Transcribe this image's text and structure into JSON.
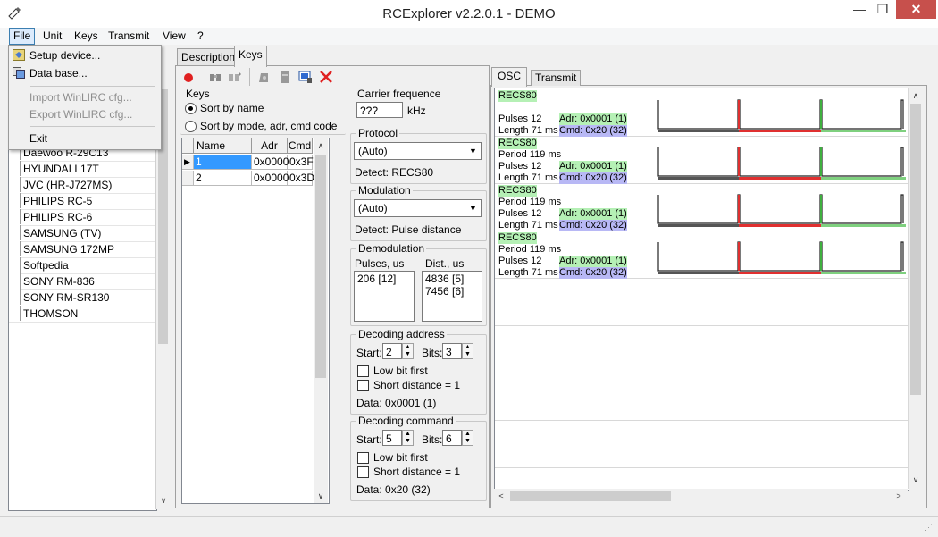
{
  "window": {
    "title": "RCExplorer v2.2.0.1 - DEMO",
    "min": "—",
    "max": "❐",
    "close": "✕"
  },
  "menu": [
    "File",
    "Unit",
    "Keys",
    "Transmit",
    "View",
    "?"
  ],
  "file_menu": {
    "setup": "Setup device...",
    "database": "Data base...",
    "import": "Import WinLIRC cfg...",
    "export": "Export WinLIRC cfg...",
    "exit": "Exit"
  },
  "devices": [
    "Daewoo R-29C13",
    "HYUNDAI L17T",
    "JVC (HR-J727MS)",
    "PHILIPS RC-5",
    "PHILIPS RC-6",
    "SAMSUNG (TV)",
    "SAMSUNG 172MP",
    "Softpedia",
    "SONY RM-836",
    "SONY RM-SR130",
    "THOMSON"
  ],
  "tabs": {
    "description": "Description",
    "keys": "Keys",
    "osc": "OSC",
    "transmit": "Transmit"
  },
  "keys_group": {
    "label": "Keys",
    "sort_name": "Sort by name",
    "sort_mode": "Sort by mode, adr, cmd code"
  },
  "grid": {
    "headers": {
      "name": "Name",
      "adr": "Adr",
      "cmd": "Cmd"
    },
    "rows": [
      {
        "name": "1",
        "adr": "0x0000",
        "cmd": "0x3F"
      },
      {
        "name": "2",
        "adr": "0x0000",
        "cmd": "0x3D"
      }
    ]
  },
  "carrier": {
    "label": "Carrier frequence",
    "value": "???",
    "unit": "kHz"
  },
  "protocol": {
    "label": "Protocol",
    "value": "(Auto)",
    "detect": "Detect: RECS80"
  },
  "modulation": {
    "label": "Modulation",
    "value": "(Auto)",
    "detect": "Detect: Pulse distance"
  },
  "demod": {
    "label": "Demodulation",
    "pulses_label": "Pulses, us",
    "dist_label": "Dist., us",
    "pulses": [
      "206 [12]"
    ],
    "dist": [
      "4836 [5]",
      "7456 [6]"
    ]
  },
  "dec_addr": {
    "label": "Decoding address",
    "start_label": "Start:",
    "start": "2",
    "bits_label": "Bits:",
    "bits": "3",
    "low_bit": "Low bit first",
    "short_dist": "Short distance = 1",
    "data": "Data: 0x0001 (1)"
  },
  "dec_cmd": {
    "label": "Decoding command",
    "start_label": "Start:",
    "start": "5",
    "bits_label": "Bits:",
    "bits": "6",
    "low_bit": "Low bit first",
    "short_dist": "Short distance = 1",
    "data": "Data: 0x20 (32)"
  },
  "signals": [
    {
      "proto": "RECS80",
      "period": "",
      "pulses": "Pulses 12",
      "adr": "Adr: 0x0001 (1)",
      "length": "Length 71 ms",
      "cmd": "Cmd: 0x20 (32)"
    },
    {
      "proto": "RECS80",
      "period": "Period 119 ms",
      "pulses": "Pulses 12",
      "adr": "Adr: 0x0001 (1)",
      "length": "Length 71 ms",
      "cmd": "Cmd: 0x20 (32)"
    },
    {
      "proto": "RECS80",
      "period": "Period 119 ms",
      "pulses": "Pulses 12",
      "adr": "Adr: 0x0001 (1)",
      "length": "Length 71 ms",
      "cmd": "Cmd: 0x20 (32)"
    },
    {
      "proto": "RECS80",
      "period": "Period 119 ms",
      "pulses": "Pulses 12",
      "adr": "Adr: 0x0001 (1)",
      "length": "Length 71 ms",
      "cmd": "Cmd: 0x20 (32)"
    }
  ],
  "colors": {
    "close": "#c7504c",
    "wave_red": "#e03030",
    "wave_green": "#b5f0b5",
    "wave_blue": "#b8b8f5"
  }
}
